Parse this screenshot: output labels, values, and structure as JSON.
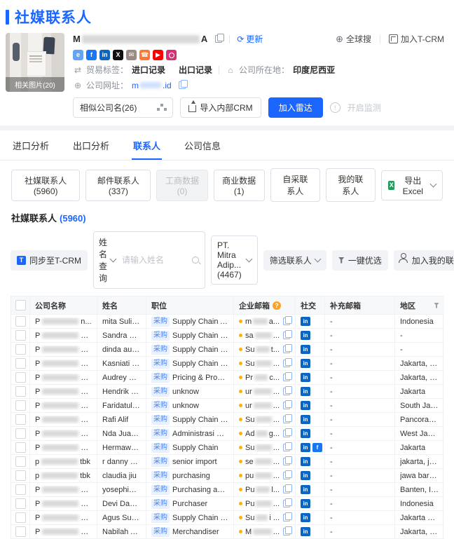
{
  "page": {
    "title": "社媒联系人"
  },
  "header_actions": {
    "global_search": "全球搜",
    "join_tcrm": "加入T-CRM"
  },
  "icons": {
    "refresh": "⟳",
    "globe": "⊕",
    "trade": "⇄",
    "location": "⌂",
    "web": "⊕"
  },
  "company": {
    "name_prefix": "M",
    "name_suffix": "A",
    "update_label": "更新",
    "photo_caption": "相关图片(20)",
    "social_icons": [
      {
        "name": "website-icon",
        "glyph": "e",
        "color": "#62a4f8"
      },
      {
        "name": "facebook-icon",
        "glyph": "f",
        "color": "#1877f2"
      },
      {
        "name": "linkedin-icon",
        "glyph": "in",
        "color": "#0a66c2"
      },
      {
        "name": "x-icon",
        "glyph": "X",
        "color": "#111111"
      },
      {
        "name": "mail-icon",
        "glyph": "✉",
        "color": "#9b8b85"
      },
      {
        "name": "phone-icon",
        "glyph": "☎",
        "color": "#ff7733"
      },
      {
        "name": "youtube-icon",
        "glyph": "▶",
        "color": "#ff0000"
      },
      {
        "name": "instagram-icon",
        "glyph": "",
        "color": "#d63076"
      }
    ],
    "trade_label": "贸易标签：",
    "trade_tags": [
      "进口记录",
      "出口记录"
    ],
    "location_label": "公司所在地：",
    "location_value": "印度尼西亚",
    "website_label": "公司网址：",
    "website_prefix": "m",
    "website_suffix": ".id",
    "similar_companies": "相似公司名(26)",
    "import_crm": "导入内部CRM",
    "join_radar": "加入雷达",
    "monitor": "开启监测"
  },
  "tabs": [
    {
      "label": "进口分析",
      "active": false
    },
    {
      "label": "出口分析",
      "active": false
    },
    {
      "label": "联系人",
      "active": true
    },
    {
      "label": "公司信息",
      "active": false
    }
  ],
  "filter_buttons": [
    {
      "label": "社媒联系人(5960)",
      "disabled": false
    },
    {
      "label": "邮件联系人(337)",
      "disabled": false
    },
    {
      "label": "工商数据(0)",
      "disabled": true
    },
    {
      "label": "商业数据(1)",
      "disabled": false
    },
    {
      "label": "自采联系人",
      "disabled": false
    },
    {
      "label": "我的联系人",
      "disabled": false
    }
  ],
  "export_excel": "导出 Excel",
  "section": {
    "title": "社媒联系人",
    "count": "(5960)"
  },
  "toolbar": {
    "sync_tcrm": "同步至T-CRM",
    "name_query": "姓名查询",
    "name_placeholder": "请输入姓名",
    "company_filter": "PT. Mitra Adip...(4467)",
    "filter_contacts": "筛选联系人",
    "one_click": "一键优选",
    "add_my_contacts": "加入我的联系人"
  },
  "table": {
    "columns": [
      "公司名称",
      "姓名",
      "职位",
      "企业邮箱",
      "社交",
      "补充邮箱",
      "地区"
    ],
    "tag_label": "采购",
    "rows": [
      {
        "company_prefix": "P",
        "company_suffix": "n...",
        "name": "mita Sulistyandari",
        "position": "Supply Chain Assistant Man...",
        "email_prefix": "m",
        "email_suffix": "a...",
        "socials": [
          "linkedin"
        ],
        "extra_email": "-",
        "region": "Indonesia"
      },
      {
        "company_prefix": "P",
        "company_suffix": "a,...",
        "name": "Sandra Sianipar",
        "position": "Supply Chain Officer",
        "email_prefix": "sa",
        "email_suffix": "...",
        "socials": [
          "linkedin"
        ],
        "extra_email": "-",
        "region": "-"
      },
      {
        "company_prefix": "P",
        "company_suffix": "a ...",
        "name": "dinda auliya adha",
        "position": "Supply Chain Officer",
        "email_prefix": "Su",
        "email_suffix": "t...",
        "socials": [
          "linkedin"
        ],
        "extra_email": "-",
        "region": "-"
      },
      {
        "company_prefix": "P",
        "company_suffix": "a ...",
        "name": "Kasniati Sinaga",
        "position": "Supply Chain Management",
        "email_prefix": "Su",
        "email_suffix": "...",
        "socials": [
          "linkedin"
        ],
        "extra_email": "-",
        "region": "Jakarta, Indonesia"
      },
      {
        "company_prefix": "P",
        "company_suffix": "a ...",
        "name": "Audrey Vellicia",
        "position": "Pricing & Promotion Execut...",
        "email_prefix": "Pr",
        "email_suffix": "c...",
        "socials": [
          "linkedin"
        ],
        "extra_email": "-",
        "region": "Jakarta, Indonesia"
      },
      {
        "company_prefix": "P",
        "company_suffix": "a ...",
        "name": "Hendrik Fendi",
        "position": "unknow",
        "email_prefix": "ur",
        "email_suffix": "...",
        "socials": [
          "linkedin"
        ],
        "extra_email": "-",
        "region": "Jakarta"
      },
      {
        "company_prefix": "P",
        "company_suffix": "a ...",
        "name": "Faridatul Hidzroh",
        "position": "unknow",
        "email_prefix": "ur",
        "email_suffix": "...",
        "socials": [
          "linkedin"
        ],
        "extra_email": "-",
        "region": "South Jakarta"
      },
      {
        "company_prefix": "P",
        "company_suffix": "a ...",
        "name": "Rafi Alif",
        "position": "Supply Chain Management ...",
        "email_prefix": "Su",
        "email_suffix": "...",
        "socials": [
          "linkedin"
        ],
        "extra_email": "-",
        "region": "Pancoran Mas, ..."
      },
      {
        "company_prefix": "P",
        "company_suffix": "a,...",
        "name": "Nda Juanda",
        "position": "Administrasi Supply Chain (...",
        "email_prefix": "Ad",
        "email_suffix": "g...",
        "socials": [
          "linkedin"
        ],
        "extra_email": "-",
        "region": "West Java, Indo..."
      },
      {
        "company_prefix": "P",
        "company_suffix": "a ...",
        "name": "Hermawan Sapu...",
        "position": "Supply Chain",
        "email_prefix": "Su",
        "email_suffix": "...",
        "socials": [
          "linkedin",
          "facebook"
        ],
        "extra_email": "-",
        "region": "Jakarta"
      },
      {
        "company_prefix": "p",
        "company_suffix": "tbk",
        "name": "r danny d nurpat...",
        "position": "senior import",
        "email_prefix": "se",
        "email_suffix": "...",
        "socials": [
          "linkedin"
        ],
        "extra_email": "-",
        "region": "jakarta, jakarta r..."
      },
      {
        "company_prefix": "p",
        "company_suffix": "tbk",
        "name": "claudia jiu",
        "position": "purchasing",
        "email_prefix": "pu",
        "email_suffix": "...",
        "socials": [
          "linkedin"
        ],
        "extra_email": "-",
        "region": "jawa barat, indo..."
      },
      {
        "company_prefix": "P",
        "company_suffix": "a ...",
        "name": "yosephine liviane",
        "position": "Purchasing analysis",
        "email_prefix": "Pu",
        "email_suffix": "l...",
        "socials": [
          "linkedin"
        ],
        "extra_email": "-",
        "region": "Banten, Indonesia"
      },
      {
        "company_prefix": "P",
        "company_suffix": "a ...",
        "name": "Devi Damayanti",
        "position": "Purchaser",
        "email_prefix": "Pu",
        "email_suffix": "...",
        "socials": [
          "linkedin"
        ],
        "extra_email": "-",
        "region": "Indonesia"
      },
      {
        "company_prefix": "P",
        "company_suffix": "a ...",
        "name": "Agus Sudiharjo",
        "position": "Supply Chain Governance In...",
        "email_prefix": "Su",
        "email_suffix": "i ...",
        "socials": [
          "linkedin"
        ],
        "extra_email": "-",
        "region": "Jakarta Metropo..."
      },
      {
        "company_prefix": "P",
        "company_suffix": "a ...",
        "name": "Nabilah Adellia",
        "position": "Merchandiser",
        "email_prefix": "M",
        "email_suffix": "...",
        "socials": [
          "linkedin"
        ],
        "extra_email": "-",
        "region": "Jakarta, Indonesia"
      }
    ]
  },
  "colors": {
    "accent": "#1a66ff",
    "tag_bg": "#e8f1ff",
    "tag_text": "#4584ff",
    "linkedin": "#0a66c2",
    "facebook": "#1877f2",
    "status_dot": "#ffb100",
    "help_badge": "#ffa021"
  }
}
